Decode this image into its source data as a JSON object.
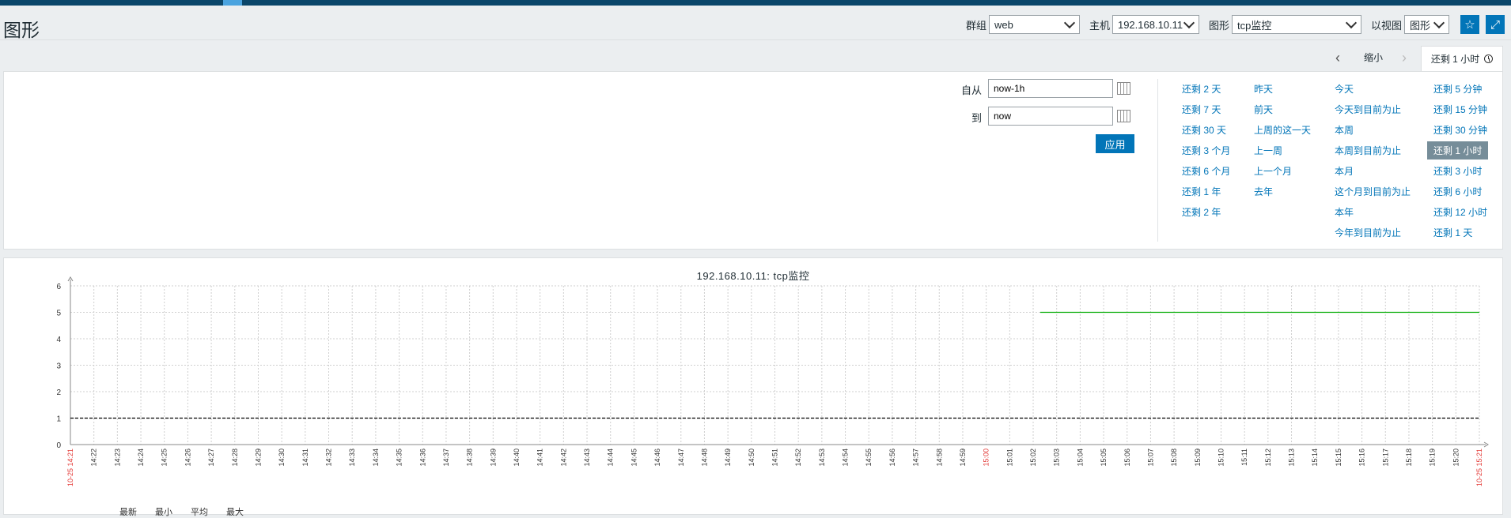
{
  "page_title": "图形",
  "filters": {
    "group_label": "群组",
    "group_value": "web",
    "host_label": "主机",
    "host_value": "192.168.10.11",
    "graph_label": "图形",
    "graph_value": "tcp监控",
    "view_label": "以视图",
    "view_value": "图形"
  },
  "timebar": {
    "zoom_out_label": "缩小",
    "current_period": "还剩 1 小时"
  },
  "time_filter": {
    "from_label": "自从",
    "from_value": "now-1h",
    "to_label": "到",
    "to_value": "now",
    "apply_label": "应用",
    "quick_ranges": [
      [
        "还剩 2 天",
        "还剩 7 天",
        "还剩 30 天",
        "还剩 3 个月",
        "还剩 6 个月",
        "还剩 1 年",
        "还剩 2 年"
      ],
      [
        "昨天",
        "前天",
        "上周的这一天",
        "上一周",
        "上一个月",
        "去年"
      ],
      [
        "今天",
        "今天到目前为止",
        "本周",
        "本周到目前为止",
        "本月",
        "这个月到目前为止",
        "本年",
        "今年到目前为止"
      ],
      [
        "还剩 5 分钟",
        "还剩 15 分钟",
        "还剩 30 分钟",
        "还剩 1 小时",
        "还剩 3 小时",
        "还剩 6 小时",
        "还剩 12 小时",
        "还剩 1 天"
      ]
    ],
    "selected_range": "还剩 1 小时"
  },
  "graph": {
    "title": "192.168.10.11: tcp监控",
    "legend_headers": [
      "最新",
      "最小",
      "平均",
      "最大"
    ]
  },
  "colors": {
    "link": "#0275b8",
    "series": "#00aa00",
    "trigger": "#000000",
    "tick_red": "#e33734"
  },
  "chart_data": {
    "type": "line",
    "title": "192.168.10.11: tcp监控",
    "ylim": [
      0,
      6
    ],
    "y_ticks": [
      "0",
      "1",
      "2",
      "3",
      "4",
      "5",
      "6"
    ],
    "x_start_label": "10-25 14:21",
    "x_end_label": "10-25 15:21",
    "x_ticks": [
      "14:22",
      "14:23",
      "14:24",
      "14:25",
      "14:26",
      "14:27",
      "14:28",
      "14:29",
      "14:30",
      "14:31",
      "14:32",
      "14:33",
      "14:34",
      "14:35",
      "14:36",
      "14:37",
      "14:38",
      "14:39",
      "14:40",
      "14:41",
      "14:42",
      "14:43",
      "14:44",
      "14:45",
      "14:46",
      "14:47",
      "14:48",
      "14:49",
      "14:50",
      "14:51",
      "14:52",
      "14:53",
      "14:54",
      "14:55",
      "14:56",
      "14:57",
      "14:58",
      "14:59",
      "15:00",
      "15:01",
      "15:02",
      "15:03",
      "15:04",
      "15:05",
      "15:06",
      "15:07",
      "15:08",
      "15:09",
      "15:10",
      "15:11",
      "15:12",
      "15:13",
      "15:14",
      "15:15",
      "15:16",
      "15:17",
      "15:18",
      "15:19",
      "15:20"
    ],
    "red_ticks": [
      "15:00"
    ],
    "series": [
      {
        "values": [
          [
            41.3,
            5
          ],
          [
            60,
            5
          ]
        ]
      }
    ],
    "trigger_lines": [
      1
    ],
    "grid": true
  }
}
